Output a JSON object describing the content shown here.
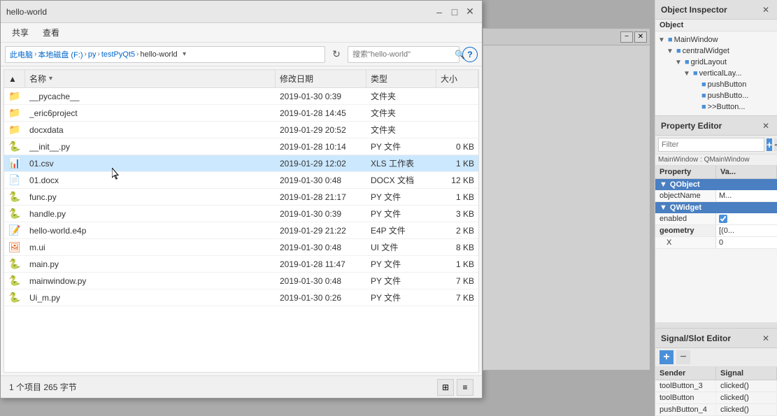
{
  "fileExplorer": {
    "title": "hello-world",
    "menuItems": [
      "共享",
      "查看"
    ],
    "breadcrumb": {
      "parts": [
        "此电脑",
        "本地磁盘 (F:)",
        "py",
        "testPyQt5",
        "hello-world"
      ],
      "separators": [
        "›",
        "›",
        "›",
        "›"
      ]
    },
    "searchPlaceholder": "搜索\"hello-world\"",
    "columns": {
      "sort": "名称",
      "modDate": "修改日期",
      "type": "类型",
      "size": "大小"
    },
    "files": [
      {
        "name": "__pycache__",
        "modDate": "2019-01-30 0:39",
        "type": "文件夹",
        "size": "",
        "icon": "folder",
        "selected": false
      },
      {
        "name": "_eric6project",
        "modDate": "2019-01-28 14:45",
        "type": "文件夹",
        "size": "",
        "icon": "folder",
        "selected": false
      },
      {
        "name": "docxdata",
        "modDate": "2019-01-29 20:52",
        "type": "文件夹",
        "size": "",
        "icon": "folder",
        "selected": false
      },
      {
        "name": "__init__.py",
        "modDate": "2019-01-28 10:14",
        "type": "PY 文件",
        "size": "0 KB",
        "icon": "py",
        "selected": false
      },
      {
        "name": "01.csv",
        "modDate": "2019-01-29 12:02",
        "type": "XLS 工作表",
        "size": "1 KB",
        "icon": "csv",
        "selected": true
      },
      {
        "name": "01.docx",
        "modDate": "2019-01-30 0:48",
        "type": "DOCX 文档",
        "size": "12 KB",
        "icon": "docx",
        "selected": false
      },
      {
        "name": "func.py",
        "modDate": "2019-01-28 21:17",
        "type": "PY 文件",
        "size": "1 KB",
        "icon": "py",
        "selected": false
      },
      {
        "name": "handle.py",
        "modDate": "2019-01-30 0:39",
        "type": "PY 文件",
        "size": "3 KB",
        "icon": "py",
        "selected": false
      },
      {
        "name": "hello-world.e4p",
        "modDate": "2019-01-29 21:22",
        "type": "E4P 文件",
        "size": "2 KB",
        "icon": "e4p",
        "selected": false
      },
      {
        "name": "m.ui",
        "modDate": "2019-01-30 0:48",
        "type": "UI 文件",
        "size": "8 KB",
        "icon": "ui",
        "selected": false
      },
      {
        "name": "main.py",
        "modDate": "2019-01-28 11:47",
        "type": "PY 文件",
        "size": "1 KB",
        "icon": "py",
        "selected": false
      },
      {
        "name": "mainwindow.py",
        "modDate": "2019-01-30 0:48",
        "type": "PY 文件",
        "size": "7 KB",
        "icon": "py",
        "selected": false
      },
      {
        "name": "Ui_m.py",
        "modDate": "2019-01-30 0:26",
        "type": "PY 文件",
        "size": "7 KB",
        "icon": "py",
        "selected": false
      }
    ],
    "statusText": "1 个项目 265 字节"
  },
  "objectInspector": {
    "title": "Object Inspector",
    "object_label": "Object",
    "tree": [
      {
        "label": "MainWindow",
        "indent": 0,
        "arrow": "▼",
        "icon": "■"
      },
      {
        "label": "centralWidget",
        "indent": 1,
        "arrow": "▼",
        "icon": "■"
      },
      {
        "label": "gridLayout",
        "indent": 2,
        "arrow": "▼",
        "icon": "■"
      },
      {
        "label": "verticalLay...",
        "indent": 3,
        "arrow": "▼",
        "icon": "■"
      },
      {
        "label": "pushButton",
        "indent": 4,
        "arrow": "",
        "icon": "□"
      },
      {
        "label": "pushButto...",
        "indent": 4,
        "arrow": "",
        "icon": "□"
      },
      {
        "label": ">>Button...",
        "indent": 4,
        "arrow": "",
        "icon": "□"
      }
    ]
  },
  "propertyEditor": {
    "title": "Property Editor",
    "filterPlaceholder": "Filter",
    "contextLabel": "MainWindow : QMainWindow",
    "columns": {
      "property": "Property",
      "value": "Va..."
    },
    "sections": [
      {
        "name": "QObject",
        "properties": [
          {
            "name": "objectName",
            "value": "M...",
            "type": "text"
          }
        ]
      },
      {
        "name": "QWidget",
        "properties": [
          {
            "name": "enabled",
            "value": "checked",
            "type": "checkbox"
          },
          {
            "name": "geometry",
            "value": "[(0...",
            "type": "text",
            "bold": true
          }
        ]
      }
    ],
    "xRow": {
      "name": "X",
      "value": "0"
    }
  },
  "signalSlotEditor": {
    "title": "Signal/Slot Editor",
    "columns": {
      "sender": "Sender",
      "signal": "Signal"
    },
    "rows": [
      {
        "sender": "toolButton_3",
        "signal": "clicked()"
      },
      {
        "sender": "toolButton",
        "signal": "clicked()"
      },
      {
        "sender": "pushButton_4",
        "signal": "clicked()"
      }
    ]
  }
}
